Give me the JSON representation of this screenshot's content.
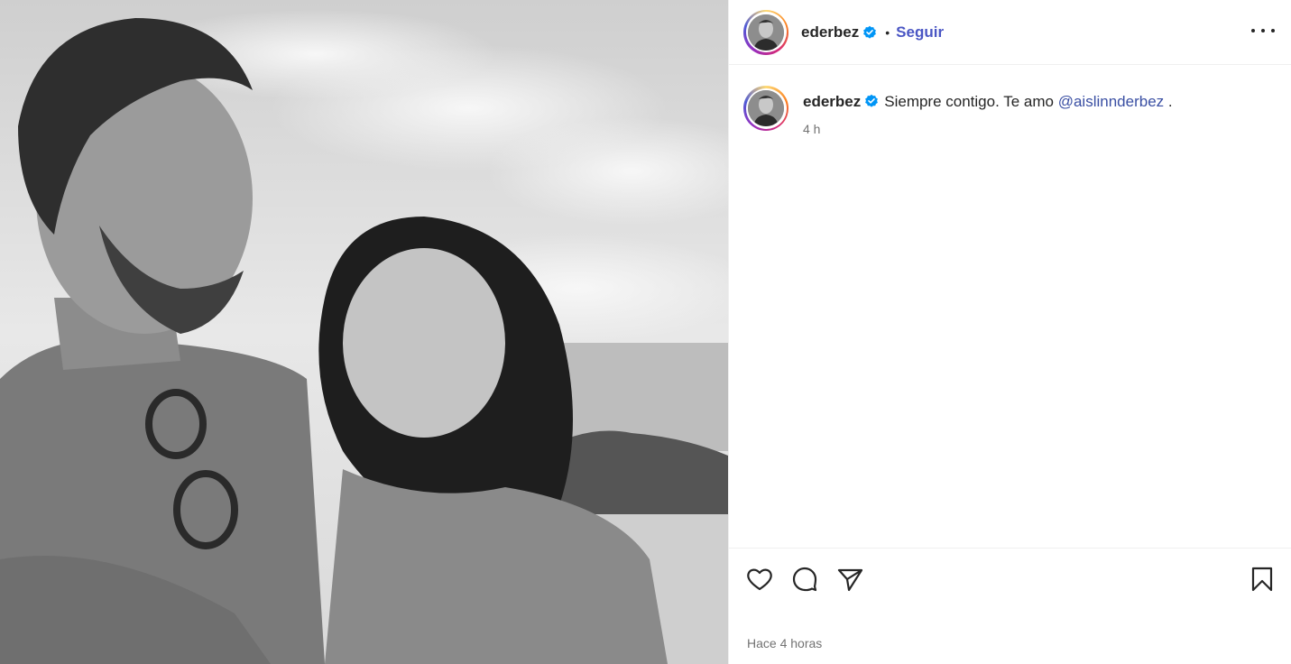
{
  "post": {
    "image_alt": "Foto en blanco y negro de un hombre y una mujer abrazados al aire libre",
    "author": {
      "username": "ederbez",
      "verified": true,
      "follow_label": "Seguir",
      "separator": "•"
    },
    "menu_icon": "more-horizontal-icon",
    "caption": {
      "username": "ederbez",
      "text": "Siempre contigo. Te amo",
      "mention": "@aislinnderbez",
      "end": ".",
      "age": "4 h"
    },
    "actions": {
      "icons": [
        "heart-icon",
        "comment-icon",
        "share-icon",
        "bookmark-icon"
      ]
    },
    "timestamp": "Hace 4 horas"
  },
  "colors": {
    "link": "#4a56c4",
    "verified": "#0095f6",
    "text": "#262626",
    "muted": "#737373",
    "divider": "#efefef"
  }
}
